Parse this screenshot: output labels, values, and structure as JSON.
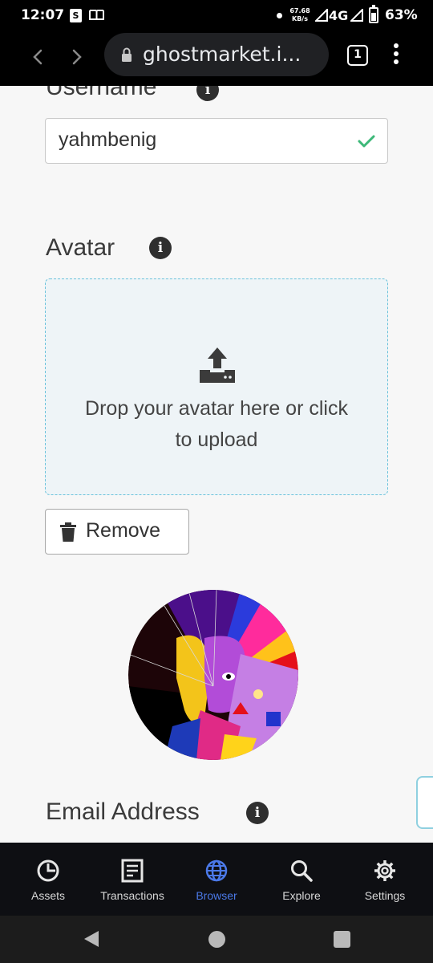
{
  "status_bar": {
    "time": "12:07",
    "shop_icon_letter": "S",
    "speed_value": "67.68",
    "speed_unit": "KB/s",
    "network": "4G",
    "battery": "63%"
  },
  "browser": {
    "url": "ghostmarket.i...",
    "tab_count": "1"
  },
  "form": {
    "username_label": "Username",
    "username_value": "yahmbenig",
    "avatar_label": "Avatar",
    "dropzone_text": "Drop your avatar here or click to upload",
    "remove_label": "Remove",
    "email_label": "Email Address",
    "info_glyph": "i"
  },
  "bottom_nav": {
    "items": [
      {
        "label": "Assets",
        "icon": "pie-chart-icon"
      },
      {
        "label": "Transactions",
        "icon": "document-icon"
      },
      {
        "label": "Browser",
        "icon": "globe-icon",
        "active": true
      },
      {
        "label": "Explore",
        "icon": "search-icon"
      },
      {
        "label": "Settings",
        "icon": "gear-icon"
      }
    ]
  },
  "colors": {
    "accent": "#4b79e8",
    "valid_check": "#3cb878",
    "dropzone_border": "#6cc3dc"
  }
}
